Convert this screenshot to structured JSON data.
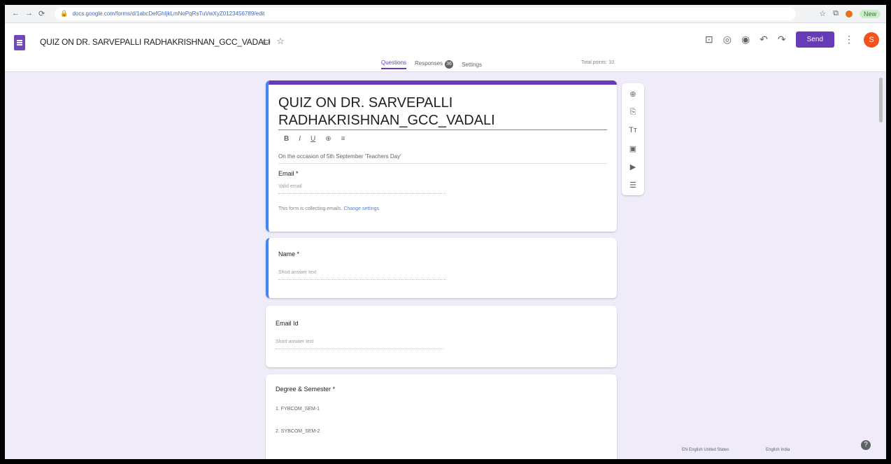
{
  "browser": {
    "back": "←",
    "forward": "→",
    "reload": "⟳",
    "url": "docs.google.com/forms/d/1abcDefGhIjkLmNoPqRsTuVwXyZ0123456789/edit",
    "new_chip": "New"
  },
  "header": {
    "form_title": "QUIZ ON DR. SARVEPALLI RADHAKRISHNAN_GCC_VADALI",
    "send_label": "Send",
    "avatar_letter": "S"
  },
  "tabs": [
    {
      "label": "Questions"
    },
    {
      "label": "Responses",
      "badge": "36"
    },
    {
      "label": "Settings"
    }
  ],
  "total_points": "Total points: 10",
  "quiz": {
    "title_line1": "QUIZ ON DR. SARVEPALLI",
    "title_line2": "RADHAKRISHNAN_GCC_VADALI",
    "description": "On the occasion of 5th September 'Teachers Day'",
    "format": [
      "B",
      "I",
      "U",
      "⊕",
      "≡"
    ]
  },
  "email_question": {
    "label": "Email *",
    "placeholder": "Valid email",
    "note": "This form is collecting emails.",
    "note_link": "Change settings"
  },
  "questions": [
    {
      "label": "Name *",
      "placeholder": "Short answer text"
    },
    {
      "label": "Email Id",
      "placeholder": "Short answer text"
    }
  ],
  "degree_question": {
    "label": "Degree & Semester *",
    "options": [
      "1. FYBCOM_SEM-1",
      "2. SYBCOM_SEM-2"
    ]
  },
  "footer": {
    "lang1": "EN English United States",
    "lang2": "English India"
  }
}
